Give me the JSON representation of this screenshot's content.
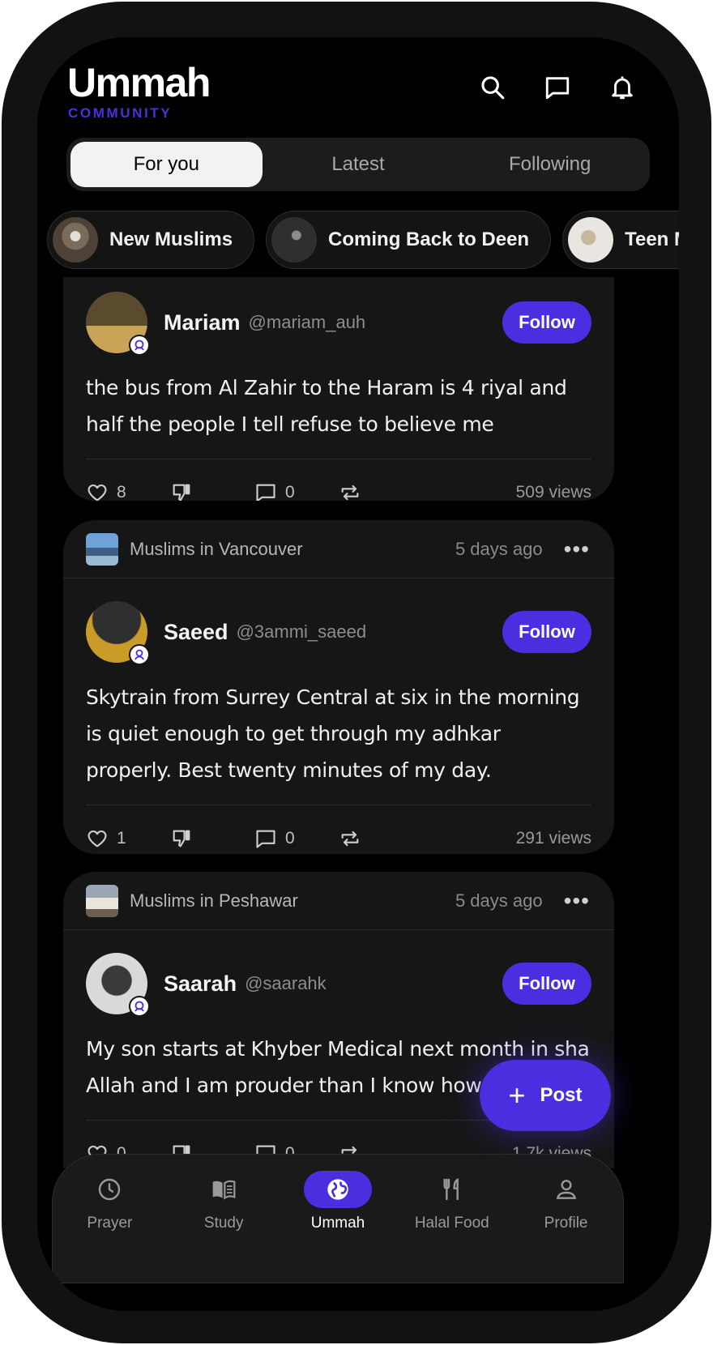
{
  "app": {
    "title": "Ummah",
    "subtitle": "COMMUNITY"
  },
  "header_icons": [
    "search-icon",
    "message-icon",
    "bell-icon"
  ],
  "tabs": [
    {
      "label": "For you",
      "active": true
    },
    {
      "label": "Latest",
      "active": false
    },
    {
      "label": "Following",
      "active": false
    }
  ],
  "chips": [
    {
      "label": "New Muslims"
    },
    {
      "label": "Coming Back to Deen"
    },
    {
      "label": "Teen M"
    }
  ],
  "posts": [
    {
      "author": "Mariam",
      "handle": "@mariam_auh",
      "follow_label": "Follow",
      "text": "the bus from Al Zahir to the Haram is 4 riyal and half the people I tell refuse to believe me",
      "likes": "8",
      "comments": "0",
      "views": "509 views"
    },
    {
      "group": "Muslims in Vancouver",
      "time": "5 days ago",
      "author": "Saeed",
      "handle": "@3ammi_saeed",
      "follow_label": "Follow",
      "text": "Skytrain from Surrey Central at six in the morning is quiet enough to get through my adhkar properly. Best twenty minutes of my day.",
      "likes": "1",
      "comments": "0",
      "views": "291 views"
    },
    {
      "group": "Muslims in Peshawar",
      "time": "5 days ago",
      "author": "Saarah",
      "handle": "@saarahk",
      "follow_label": "Follow",
      "text": "My son starts at Khyber Medical next month in sha Allah and I am prouder than I know how t",
      "likes": "0",
      "comments": "0",
      "views": "1.7k views"
    }
  ],
  "fab": {
    "label": "Post"
  },
  "nav": [
    {
      "label": "Prayer",
      "icon": "clock-icon",
      "active": false
    },
    {
      "label": "Study",
      "icon": "book-icon",
      "active": false
    },
    {
      "label": "Ummah",
      "icon": "globe-icon",
      "active": true
    },
    {
      "label": "Halal Food",
      "icon": "utensils-icon",
      "active": false
    },
    {
      "label": "Profile",
      "icon": "person-icon",
      "active": false
    }
  ],
  "colors": {
    "accent": "#4a2ee0",
    "background": "#000000",
    "card": "#161616"
  }
}
